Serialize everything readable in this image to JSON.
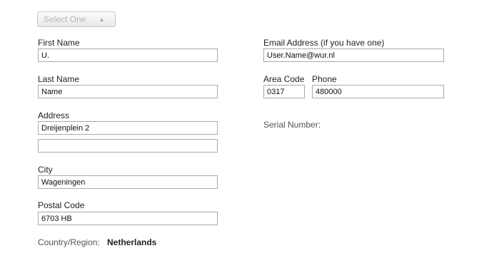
{
  "select": {
    "value": "Select One"
  },
  "left": {
    "first_name": {
      "label": "First Name",
      "value": "U."
    },
    "last_name": {
      "label": "Last Name",
      "value": "Name"
    },
    "address": {
      "label": "Address",
      "line1": "Dreijenplein 2",
      "line2": ""
    },
    "city": {
      "label": "City",
      "value": "Wageningen"
    },
    "postal_code": {
      "label": "Postal Code",
      "value": "6703 HB"
    },
    "country": {
      "label": "Country/Region:",
      "value": "Netherlands"
    }
  },
  "right": {
    "email": {
      "label": "Email Address (if you have one)",
      "value": "User.Name@wur.nl"
    },
    "area_code": {
      "label": "Area Code",
      "value": "0317"
    },
    "phone": {
      "label": "Phone",
      "value": "480000"
    },
    "serial": {
      "label": "Serial Number:"
    }
  }
}
